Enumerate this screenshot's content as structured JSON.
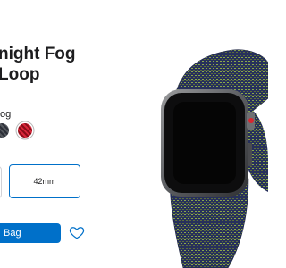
{
  "product": {
    "title": "night Fog\nLoop"
  },
  "color": {
    "label": "og",
    "swatches": [
      {
        "name": "dark-gray-loop",
        "color": "#3b3e46"
      },
      {
        "name": "red-loop",
        "color": "#c41a2b",
        "selected": true
      }
    ]
  },
  "size": {
    "options": [
      "42mm"
    ],
    "selected": "42mm"
  },
  "actions": {
    "add_to_bag": "Bag"
  },
  "colors": {
    "accent": "#0070c9",
    "band_navy": "#2a3563",
    "band_green": "#8aa84a"
  }
}
